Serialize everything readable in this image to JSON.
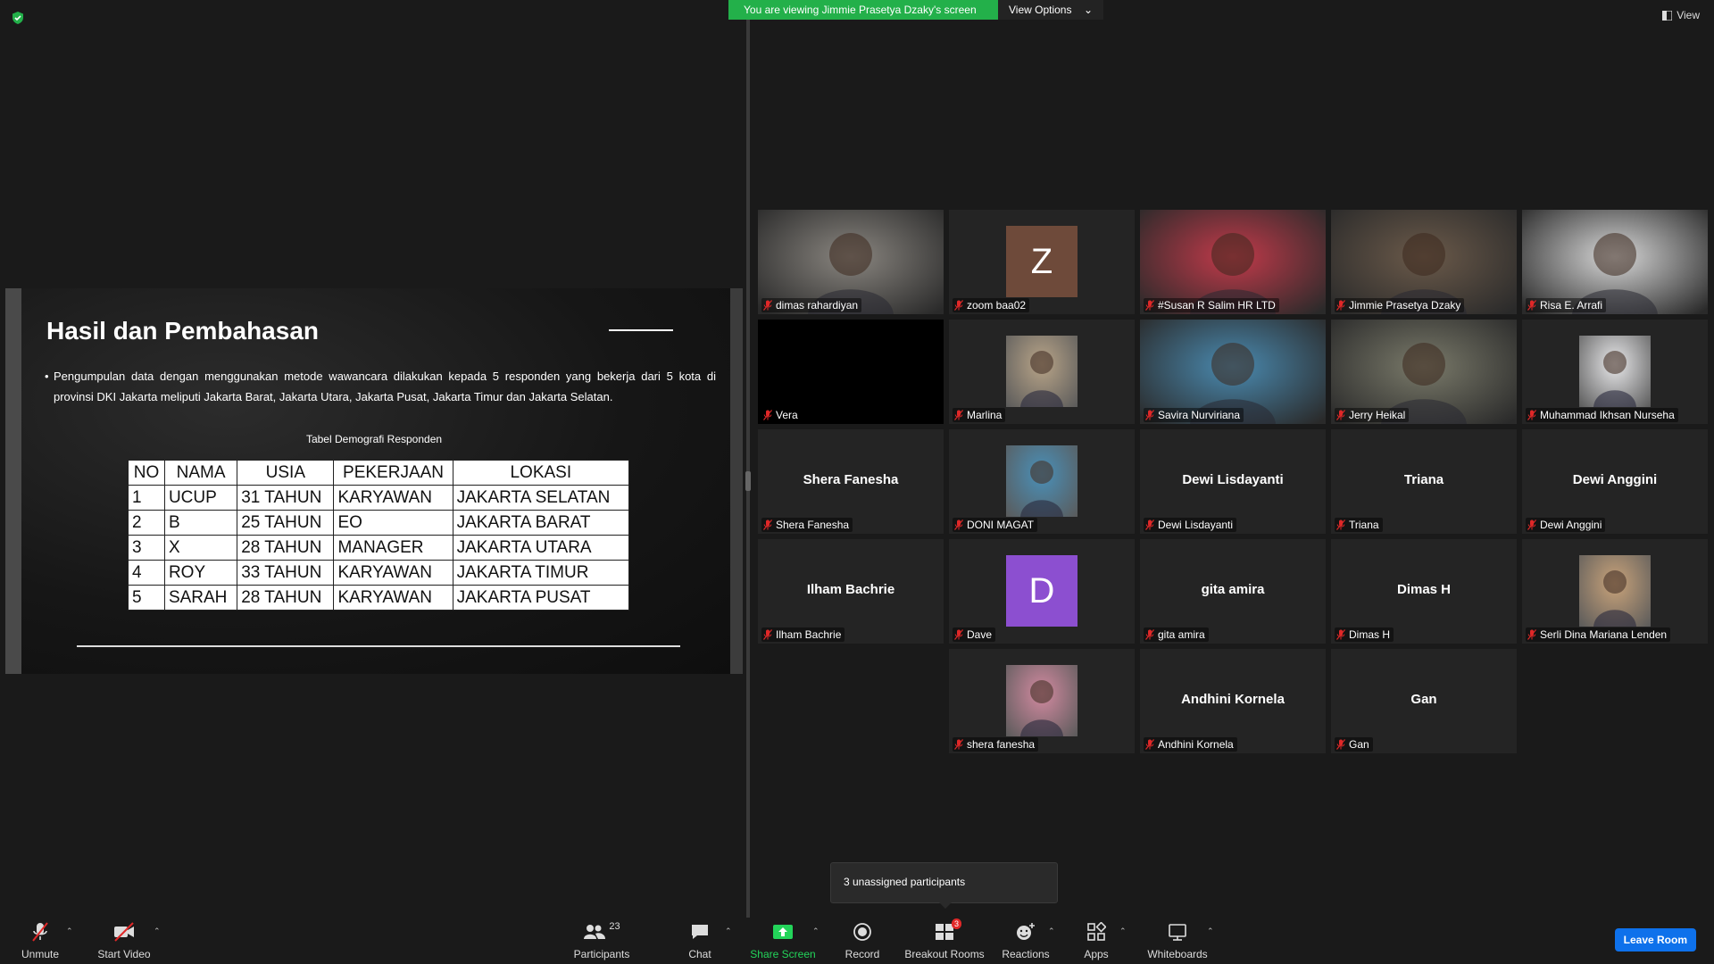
{
  "banner": {
    "text": "You are viewing Jimmie Prasetya Dzaky's screen",
    "view_options": "View Options"
  },
  "view_button": "View",
  "slide": {
    "title": "Hasil dan Pembahasan",
    "bullet": "Pengumpulan data dengan menggunakan metode wawancara dilakukan kepada 5 responden yang bekerja dari 5 kota di provinsi DKI Jakarta meliputi Jakarta Barat, Jakarta Utara, Jakarta Pusat, Jakarta Timur dan Jakarta Selatan.",
    "table_caption": "Tabel Demografi Responden",
    "table": {
      "headers": [
        "NO",
        "NAMA",
        "USIA",
        "PEKERJAAN",
        "LOKASI"
      ],
      "rows": [
        [
          "1",
          "UCUP",
          "31 TAHUN",
          "KARYAWAN",
          "JAKARTA SELATAN"
        ],
        [
          "2",
          "B",
          "25 TAHUN",
          "EO",
          "JAKARTA BARAT"
        ],
        [
          "3",
          "X",
          "28 TAHUN",
          "MANAGER",
          "JAKARTA UTARA"
        ],
        [
          "4",
          "ROY",
          "33 TAHUN",
          "KARYAWAN",
          "JAKARTA TIMUR"
        ],
        [
          "5",
          "SARAH",
          "28 TAHUN",
          "KARYAWAN",
          "JAKARTA PUSAT"
        ]
      ]
    }
  },
  "participants": [
    {
      "name": "dimas rahardiyan",
      "type": "video",
      "color": "#8a8680"
    },
    {
      "name": "zoom baa02",
      "type": "letter",
      "letter": "Z",
      "color": "#6e4a3a"
    },
    {
      "name": "#Susan R Salim HR LTD",
      "type": "video",
      "color": "#c23a4a"
    },
    {
      "name": "Jimmie Prasetya Dzaky",
      "type": "video",
      "color": "#6b5a4a",
      "active": true
    },
    {
      "name": "Risa E. Arrafi",
      "type": "video",
      "color": "#d8d8d8"
    },
    {
      "name": "Vera",
      "type": "black",
      "color": "#000000"
    },
    {
      "name": "Marlina",
      "type": "photo",
      "color": "#b8a488"
    },
    {
      "name": "Savira Nurviriana",
      "type": "video",
      "color": "#4a8ab0"
    },
    {
      "name": "Jerry Heikal",
      "type": "video",
      "color": "#7a7a6a"
    },
    {
      "name": "Muhammad Ikhsan Nurseha",
      "type": "photo",
      "color": "#e8e8ea"
    },
    {
      "name": "Shera Fanesha",
      "type": "name"
    },
    {
      "name": "DONI MAGAT",
      "type": "photo",
      "color": "#4a90b8"
    },
    {
      "name": "Dewi Lisdayanti",
      "type": "name"
    },
    {
      "name": "Triana",
      "type": "name"
    },
    {
      "name": "Dewi Anggini",
      "type": "name"
    },
    {
      "name": "Ilham Bachrie",
      "type": "name"
    },
    {
      "name": "Dave",
      "type": "letter",
      "letter": "D",
      "color": "#8c4fd0"
    },
    {
      "name": "gita amira",
      "type": "name"
    },
    {
      "name": "Dimas H",
      "type": "name"
    },
    {
      "name": "Serli Dina Mariana Lenden",
      "type": "photo",
      "color": "#c9a37a"
    },
    {
      "name": "shera fanesha",
      "type": "photo",
      "color": "#d28aa0"
    },
    {
      "name": "Andhini Kornela",
      "type": "name"
    },
    {
      "name": "Gan",
      "type": "name"
    }
  ],
  "tooltip": "3 unassigned participants",
  "toolbar": {
    "unmute": "Unmute",
    "start_video": "Start Video",
    "participants": "Participants",
    "participants_count": "23",
    "chat": "Chat",
    "share_screen": "Share Screen",
    "record": "Record",
    "breakout_rooms": "Breakout Rooms",
    "breakout_badge": "3",
    "reactions": "Reactions",
    "apps": "Apps",
    "whiteboards": "Whiteboards",
    "leave": "Leave Room"
  },
  "colors": {
    "share_green": "#23b04a",
    "active_speaker": "#c9f54a",
    "leave_blue": "#0e71eb"
  }
}
